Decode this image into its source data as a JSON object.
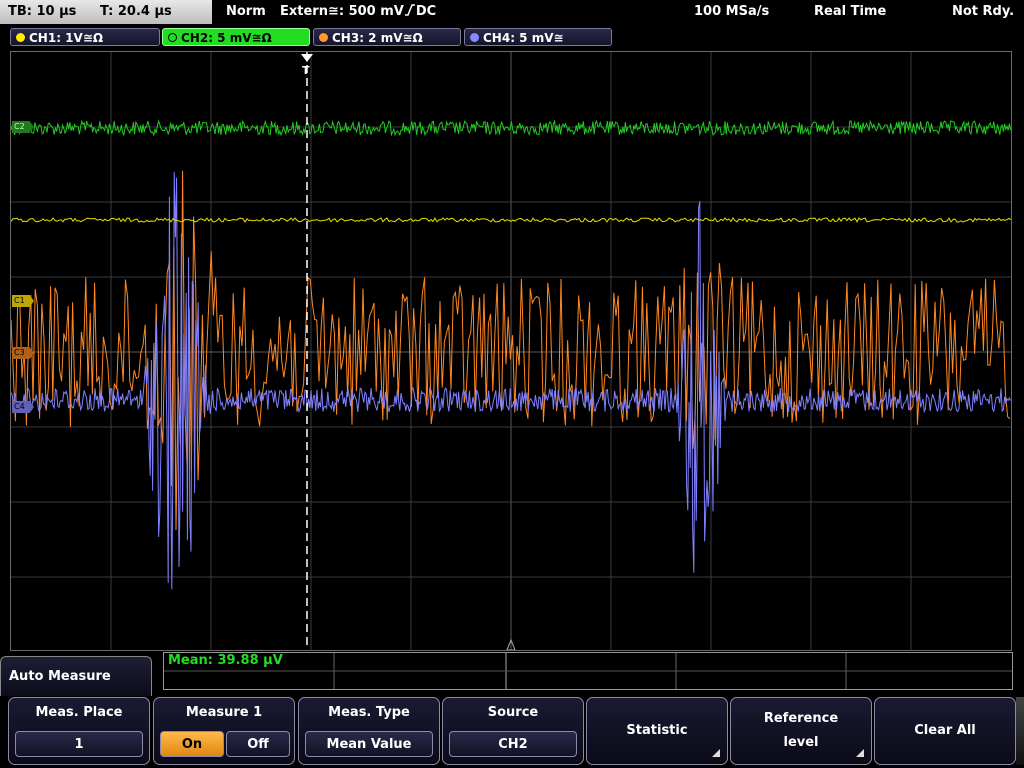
{
  "topbar": {
    "tb": "TB: 10 µs",
    "t": "T: 20.4 µs",
    "mode": "Norm",
    "trigger": "Extern≅: 500 mV",
    "trigger_slope": "DC",
    "rate": "100 MSa/s",
    "acq": "Real Time",
    "state": "Not Rdy."
  },
  "channels": [
    {
      "label": "CH1: 1V≅Ω",
      "color": "#ffee00"
    },
    {
      "label": "CH2: 5 mV≅Ω",
      "color": "#22dd22"
    },
    {
      "label": "CH3: 2 mV≅Ω",
      "color": "#ff9933"
    },
    {
      "label": "CH4: 5 mV≅",
      "color": "#8888ff"
    }
  ],
  "markers": {
    "c2": "C2",
    "c1": "C1",
    "c3": "C3",
    "c4": "C4",
    "trigger": "T"
  },
  "measurement": {
    "text": "Mean: 39.88 µV"
  },
  "menu": {
    "title": "Auto Measure",
    "meas_place": {
      "title": "Meas. Place",
      "value": "1"
    },
    "measure1": {
      "title": "Measure 1",
      "on": "On",
      "off": "Off",
      "active": "On"
    },
    "meas_type": {
      "title": "Meas. Type",
      "value": "Mean Value"
    },
    "source": {
      "title": "Source",
      "value": "CH2"
    },
    "statistic": "Statistic",
    "reference_level": "Reference level",
    "clear_all": "Clear All"
  }
}
